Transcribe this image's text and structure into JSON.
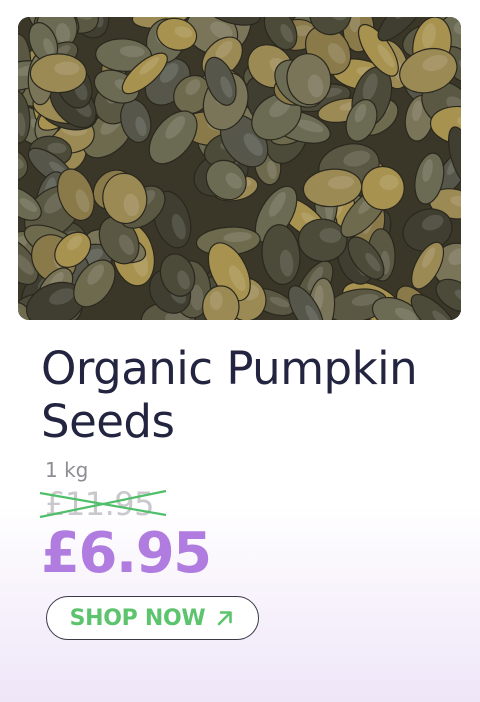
{
  "product": {
    "image_alt": "pumpkin seeds",
    "title": "Organic Pumpkin Seeds",
    "weight": "1 kg",
    "old_price": "£11.95",
    "new_price": "£6.95"
  },
  "cta": {
    "label": "SHOP NOW",
    "icon": "arrow-up-right-icon"
  },
  "colors": {
    "title": "#232540",
    "sale_price": "#b07ce0",
    "cta_text": "#5cc46c",
    "strike": "#4fbf6a"
  }
}
